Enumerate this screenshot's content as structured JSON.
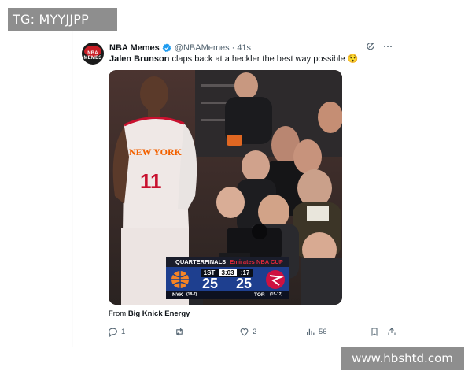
{
  "watermark_top": "TG: MYYJJPP",
  "watermark_bottom": "www.hbshtd.com",
  "tweet": {
    "avatar_text": "NBA MEMES",
    "display_name": "NBA Memes",
    "handle": "@NBAMemes",
    "separator": "·",
    "time": "41s",
    "text_bold": "Jalen Brunson",
    "text_rest": " claps back at a heckler the best way possible 😯",
    "media": {
      "jersey_team": "NEW YORK",
      "jersey_number": "11",
      "scorebug": {
        "round": "QUARTERFINALS",
        "cup": "Emirates NBA CUP",
        "period": "1ST",
        "clock": "3:03",
        "shot_clock": ":17",
        "home_score": "25",
        "away_score": "25",
        "home_team": "NYK",
        "home_record": "(18-7)",
        "away_team": "TOR",
        "away_record": "(15-12)"
      }
    },
    "from_label": "From",
    "from_source": "Big Knick Energy",
    "replies": "1",
    "likes": "2",
    "views": "56"
  },
  "colors": {
    "text": "#0f1419",
    "muted": "#536471",
    "verified": "#1d9bf0",
    "knicks_blue": "#1e3f8f",
    "raptors_red": "#ce1141"
  }
}
